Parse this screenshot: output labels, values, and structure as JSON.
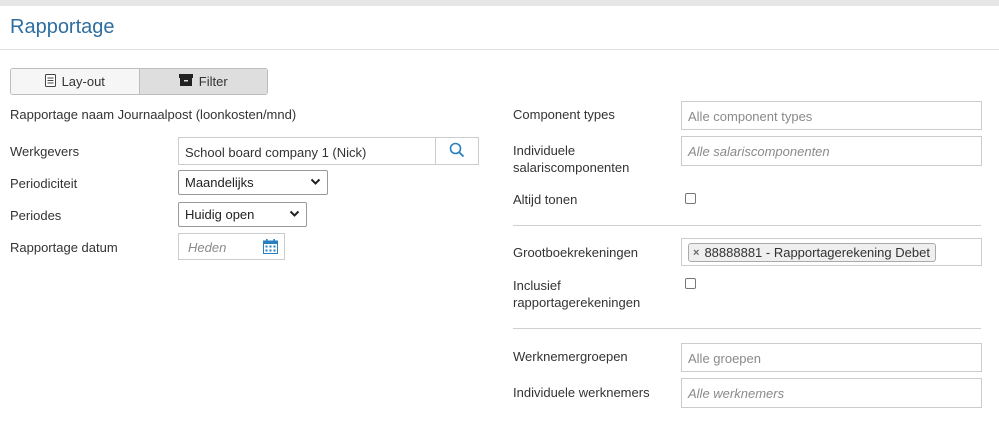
{
  "page": {
    "title": "Rapportage"
  },
  "tabs": [
    {
      "label": "Lay-out",
      "icon": "document-icon",
      "active": false
    },
    {
      "label": "Filter",
      "icon": "archive-box-icon",
      "active": true
    }
  ],
  "report_name": "Rapportage naam Journaalpost (loonkosten/mnd)",
  "left": {
    "werkgevers": {
      "label": "Werkgevers",
      "value": "School board company 1 (Nick)"
    },
    "periodiciteit": {
      "label": "Periodiciteit",
      "value": "Maandelijks"
    },
    "periodes": {
      "label": "Periodes",
      "value": "Huidig open"
    },
    "rapportage_datum": {
      "label": "Rapportage datum",
      "placeholder": "Heden"
    }
  },
  "right": {
    "component_types": {
      "label": "Component types",
      "placeholder": "Alle component types"
    },
    "individuele_salariscomponenten": {
      "label_line1": "Individuele",
      "label_line2": "salariscomponenten",
      "placeholder": "Alle salariscomponenten"
    },
    "altijd_tonen": {
      "label": "Altijd tonen",
      "checked": false
    },
    "grootboekrekeningen": {
      "label": "Grootboekrekeningen",
      "tag": "88888881 - Rapportagerekening Debet"
    },
    "inclusief": {
      "label_line1": "Inclusief",
      "label_line2": "rapportagerekeningen",
      "checked": false
    },
    "werknemergroepen": {
      "label": "Werknemergroepen",
      "placeholder": "Alle groepen"
    },
    "individuele_werknemers": {
      "label": "Individuele werknemers",
      "placeholder": "Alle werknemers"
    }
  },
  "colors": {
    "title": "#2f6ea0",
    "accent": "#2a7fc1"
  }
}
